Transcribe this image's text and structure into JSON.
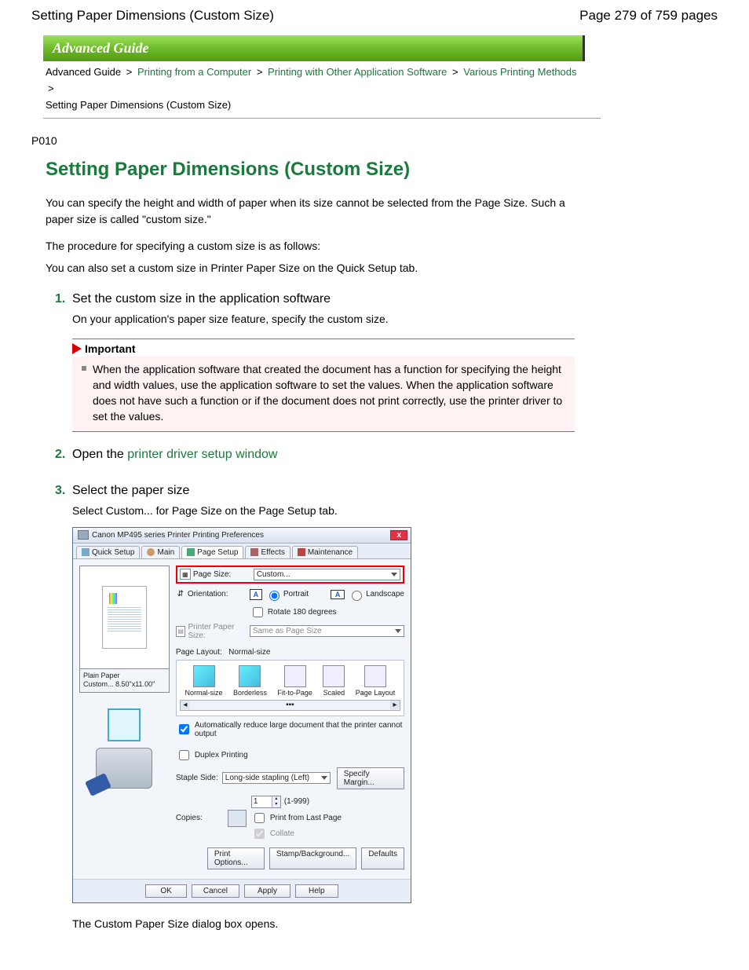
{
  "header": {
    "title": "Setting Paper Dimensions (Custom Size)",
    "page_indicator": "Page 279 of 759 pages"
  },
  "banner": "Advanced Guide",
  "breadcrumb": {
    "root": "Advanced Guide",
    "l1": "Printing from a Computer",
    "l2": "Printing with Other Application Software",
    "l3": "Various Printing Methods",
    "current": "Setting Paper Dimensions (Custom Size)",
    "sep": ">"
  },
  "code": "P010",
  "title": "Setting Paper Dimensions (Custom Size)",
  "intro1": "You can specify the height and width of paper when its size cannot be selected from the Page Size. Such a paper size is called \"custom size.\"",
  "intro2": "The procedure for specifying a custom size is as follows:",
  "intro3": "You can also set a custom size in Printer Paper Size on the Quick Setup tab.",
  "steps": {
    "s1_num": "1.",
    "s1_title": "Set the custom size in the application software",
    "s1_sub": "On your application's paper size feature, specify the custom size.",
    "s2_num": "2.",
    "s2_title_before": "Open the ",
    "s2_link": "printer driver setup window",
    "s3_num": "3.",
    "s3_title": "Select the paper size",
    "s3_sub": "Select Custom... for Page Size on the Page Setup tab."
  },
  "important": {
    "heading": "Important",
    "text": "When the application software that created the document has a function for specifying the height and width values, use the application software to set the values. When the application software does not have such a function or if the document does not print correctly, use the printer driver to set the values."
  },
  "dialog": {
    "title": "Canon MP495 series Printer Printing Preferences",
    "close": "x",
    "tabs": {
      "qs": "Quick Setup",
      "main": "Main",
      "ps": "Page Setup",
      "ef": "Effects",
      "mn": "Maintenance"
    },
    "preview": {
      "line1": "Plain Paper",
      "line2": "Custom... 8.50\"x11.00\""
    },
    "labels": {
      "page_size": "Page Size:",
      "orientation": "Orientation:",
      "portrait": "Portrait",
      "landscape": "Landscape",
      "rotate": "Rotate 180 degrees",
      "printer_paper": "Printer Paper Size:",
      "page_layout": "Page Layout:",
      "normal_size_val": "Normal-size",
      "auto_reduce": "Automatically reduce large document that the printer cannot output",
      "duplex": "Duplex Printing",
      "staple": "Staple Side:",
      "specify_margin": "Specify Margin...",
      "copies": "Copies:",
      "copies_range": "(1-999)",
      "print_last": "Print from Last Page",
      "collate": "Collate",
      "print_options": "Print Options...",
      "stamp_bg": "Stamp/Background...",
      "defaults": "Defaults"
    },
    "values": {
      "page_size": "Custom...",
      "printer_paper": "Same as Page Size",
      "staple": "Long-side stapling (Left)",
      "copies": "1"
    },
    "layout_items": {
      "normal": "Normal-size",
      "borderless": "Borderless",
      "fit": "Fit-to-Page",
      "scaled": "Scaled",
      "pl": "Page Layout"
    },
    "footer": {
      "ok": "OK",
      "cancel": "Cancel",
      "apply": "Apply",
      "help": "Help"
    }
  },
  "after_dialog": "The Custom Paper Size dialog box opens."
}
